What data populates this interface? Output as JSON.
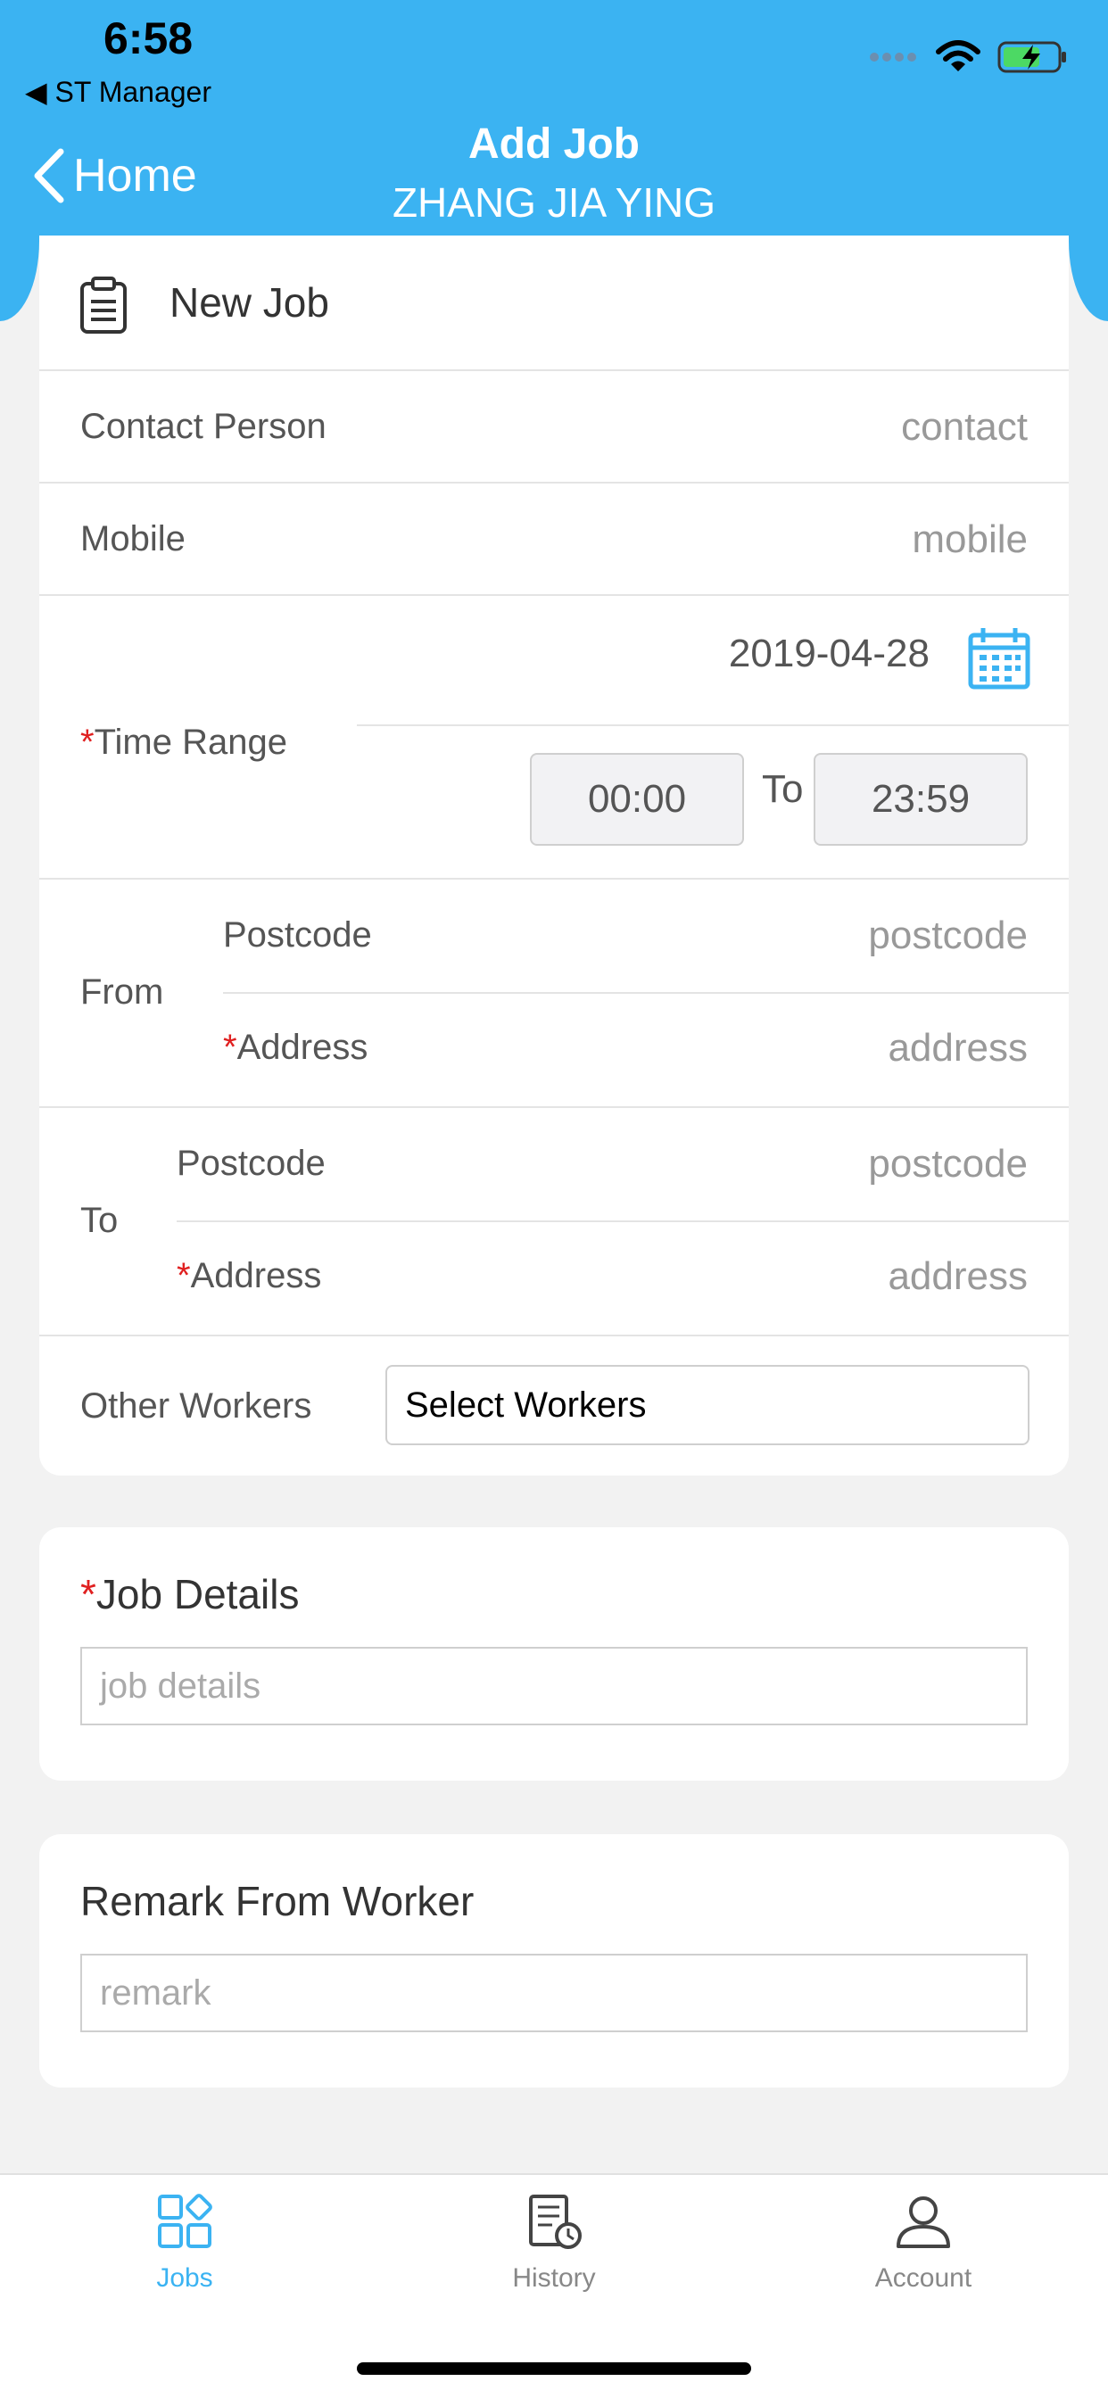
{
  "status_bar": {
    "time": "6:58",
    "back_app": "◀ ST Manager"
  },
  "nav": {
    "back_label": "Home",
    "title": "Add Job",
    "subtitle": "ZHANG JIA YING"
  },
  "form": {
    "section_title": "New Job",
    "contact_label": "Contact Person",
    "contact_placeholder": "contact",
    "mobile_label": "Mobile",
    "mobile_placeholder": "mobile",
    "required_mark": "*",
    "time_range_label": "Time Range",
    "date": "2019-04-28",
    "time_start": "00:00",
    "time_to": "To",
    "time_end": "23:59",
    "from_label": "From",
    "from_postcode_label": "Postcode",
    "from_postcode_placeholder": "postcode",
    "from_address_label": "Address",
    "from_address_placeholder": "address",
    "to_label": "To",
    "to_postcode_label": "Postcode",
    "to_postcode_placeholder": "postcode",
    "to_address_label": "Address",
    "to_address_placeholder": "address",
    "other_workers_label": "Other Workers",
    "select_workers": "Select Workers"
  },
  "job_details": {
    "title": "Job Details",
    "placeholder": "job details"
  },
  "remark": {
    "title": "Remark From Worker",
    "placeholder": "remark"
  },
  "tabbar": {
    "tabs": [
      {
        "label": "Jobs",
        "icon": "grid-icon",
        "active": true
      },
      {
        "label": "History",
        "icon": "history-icon",
        "active": false
      },
      {
        "label": "Account",
        "icon": "user-icon",
        "active": false
      }
    ]
  },
  "colors": {
    "accent": "#3bb3f2",
    "required": "#e02020",
    "tab_inactive": "#888888"
  }
}
